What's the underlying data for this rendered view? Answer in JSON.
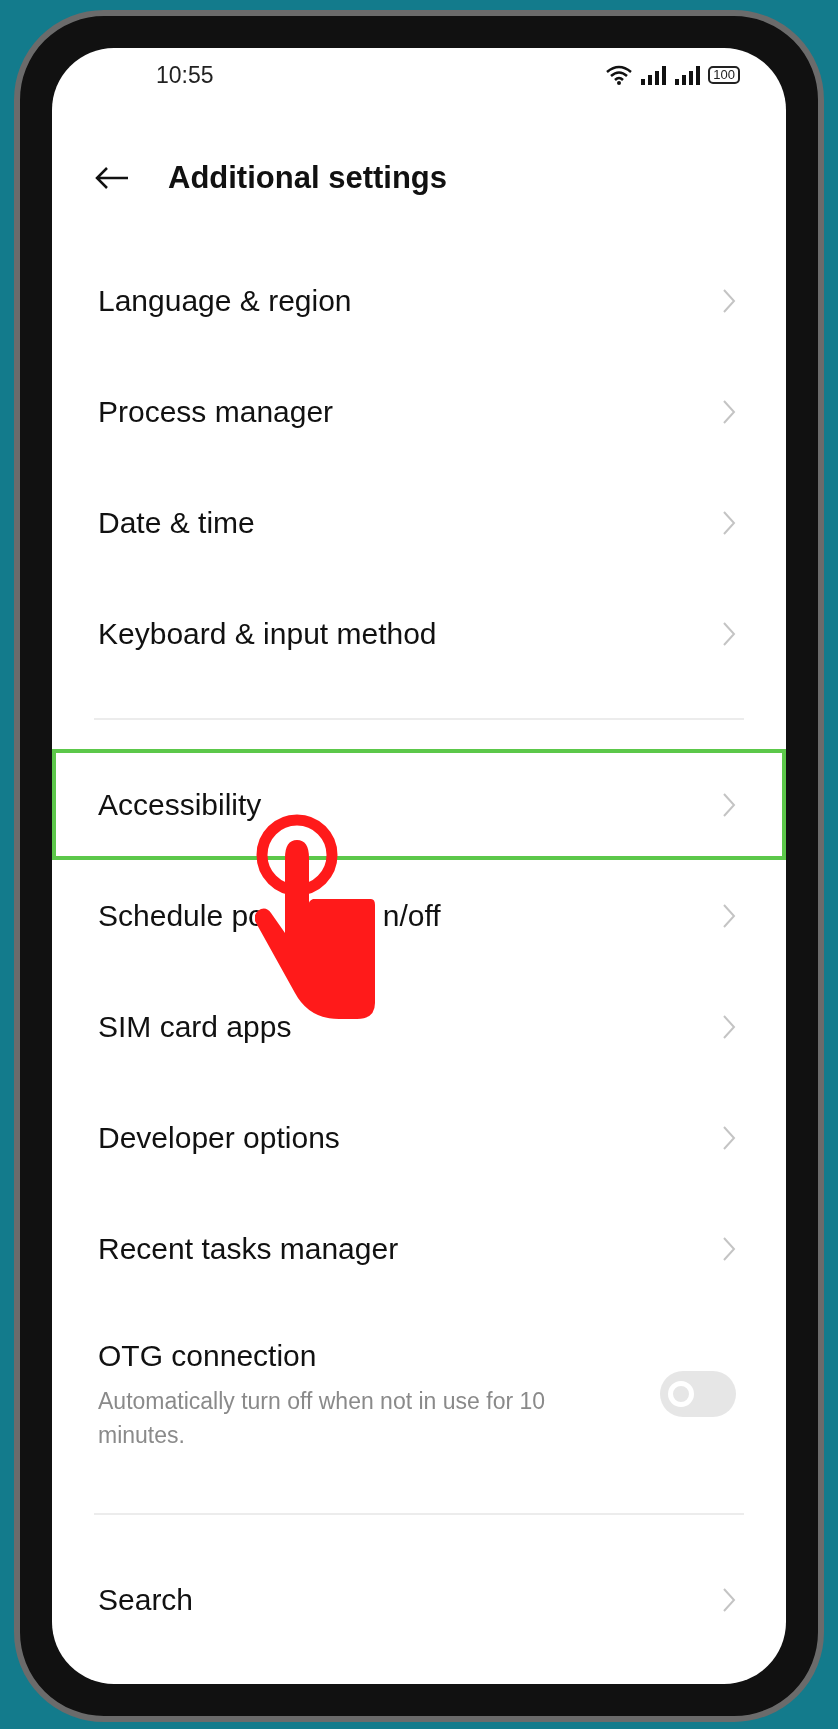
{
  "status_bar": {
    "time": "10:55",
    "battery": "100"
  },
  "header": {
    "title": "Additional settings"
  },
  "sections": [
    {
      "items": [
        {
          "kind": "link",
          "label": "Language & region",
          "highlighted": false
        },
        {
          "kind": "link",
          "label": "Process manager",
          "highlighted": false
        },
        {
          "kind": "link",
          "label": "Date & time",
          "highlighted": false
        },
        {
          "kind": "link",
          "label": "Keyboard & input method",
          "highlighted": false
        }
      ]
    },
    {
      "items": [
        {
          "kind": "link",
          "label": "Accessibility",
          "highlighted": true
        },
        {
          "kind": "covered_link",
          "label_parts": [
            "Schedule po",
            "n/off"
          ],
          "highlighted": false
        },
        {
          "kind": "link",
          "label": "SIM card apps",
          "highlighted": false
        },
        {
          "kind": "link",
          "label": "Developer options",
          "highlighted": false
        },
        {
          "kind": "link",
          "label": "Recent tasks manager",
          "highlighted": false
        },
        {
          "kind": "toggle",
          "label": "OTG connection",
          "description": "Automatically turn off when not in use for 10 minutes.",
          "on": false,
          "highlighted": false
        }
      ]
    },
    {
      "items": [
        {
          "kind": "link",
          "label": "Search",
          "highlighted": false
        }
      ]
    }
  ]
}
